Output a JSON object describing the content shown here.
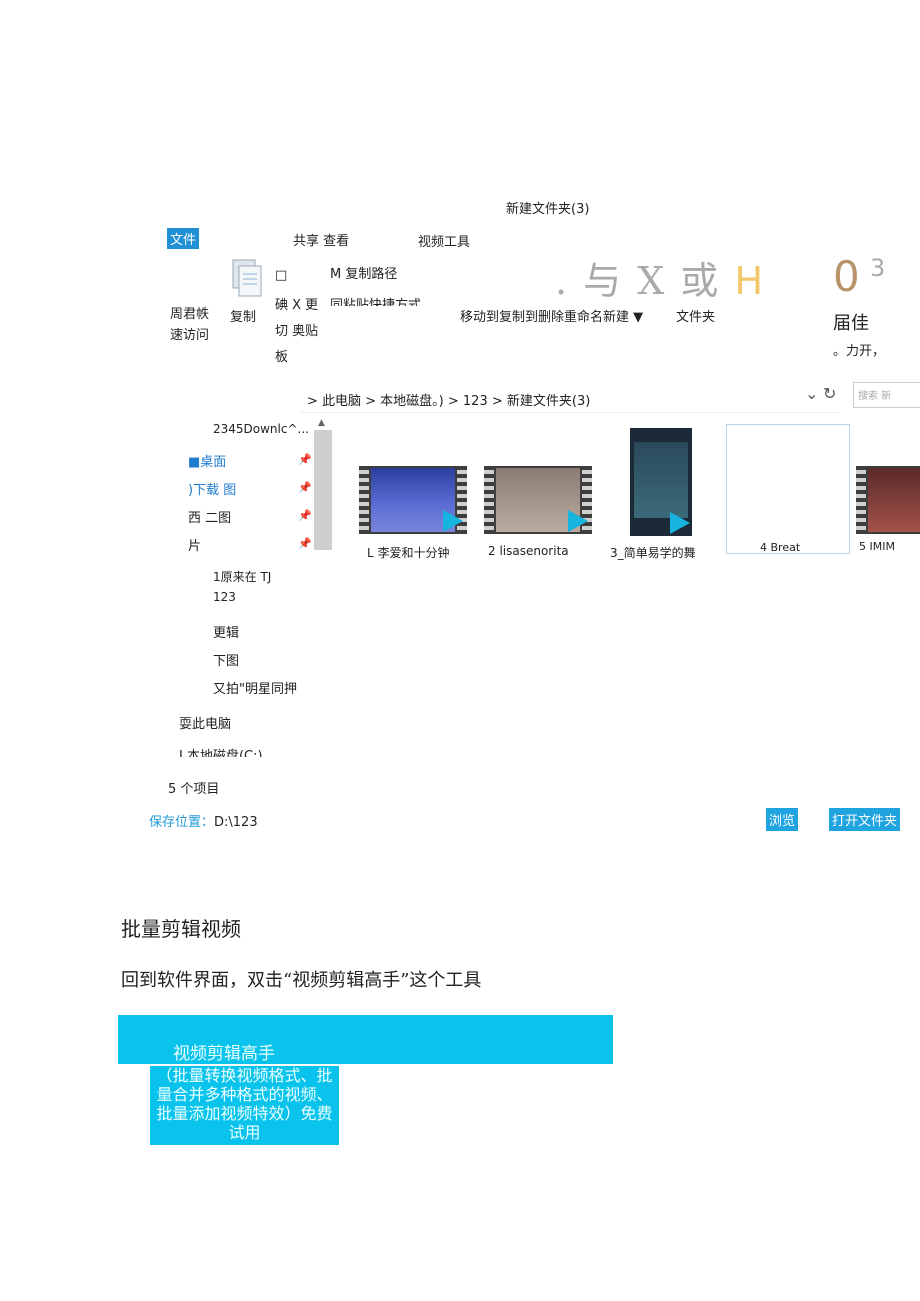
{
  "window": {
    "title": "新建文件夹(3)"
  },
  "ribbon": {
    "file_tab": "文件",
    "tabs": "共享 查看",
    "video_tools": "视频工具",
    "quick_access": [
      "周君帙",
      "速访问"
    ],
    "copy": "复制",
    "small_box": "□",
    "clip_col": [
      "碘 X 更",
      "切 奥贴",
      "板"
    ],
    "copy_path": "M 复制路径",
    "paste_shortcut": "同粘贴快捷方式",
    "organize": "移动到复制到删除重命名新建 ▼",
    "folder": "文件夹",
    "glyphs": ". 与 X 或",
    "glyph_h": "H",
    "big_num": "0",
    "small_num": "3",
    "right_label": "届佳",
    "right_open": "。力开，"
  },
  "address": {
    "path": "> 此电脑 > 本地磁盘。) > 123 > 新建文件夹(3)",
    "dropdown": "⌄",
    "refresh": "↻",
    "search": "搜索 新"
  },
  "nav": {
    "items": [
      "2345Downlc^...",
      "■桌面",
      ")下载 图",
      "西 二图",
      "片",
      "1原来在 TJ",
      "123",
      "更辑",
      "下图",
      "又拍\"明星同押"
    ],
    "this_pc": "耍此电脑",
    "local_disk": "J 本地磁盘(C:)",
    "pin_icon": "pin-icon"
  },
  "files": [
    {
      "name": "L 李爱和十分钟"
    },
    {
      "name": "2 lisasenorita"
    },
    {
      "name": "3_简单易学的舞"
    },
    {
      "name": "4 Breat"
    },
    {
      "name": "5 IMIM"
    }
  ],
  "status": {
    "count": "5 个项目"
  },
  "save": {
    "label": "保存位置：",
    "path": "D:\\123",
    "browse": "浏览",
    "open_folder": "打开文件夹"
  },
  "doc": {
    "heading": "批量剪辑视频",
    "paragraph": "回到软件界面，双击“视频剪辑高手”这个工具"
  },
  "tool": {
    "name": "视频剪辑高手",
    "description": "（批量转换视频格式、批量合并多种格式的视频、批量添加视频特效）免费试用"
  },
  "colors": {
    "accent": "#1fa4e0",
    "tool_bg": "#0ac3ed"
  }
}
